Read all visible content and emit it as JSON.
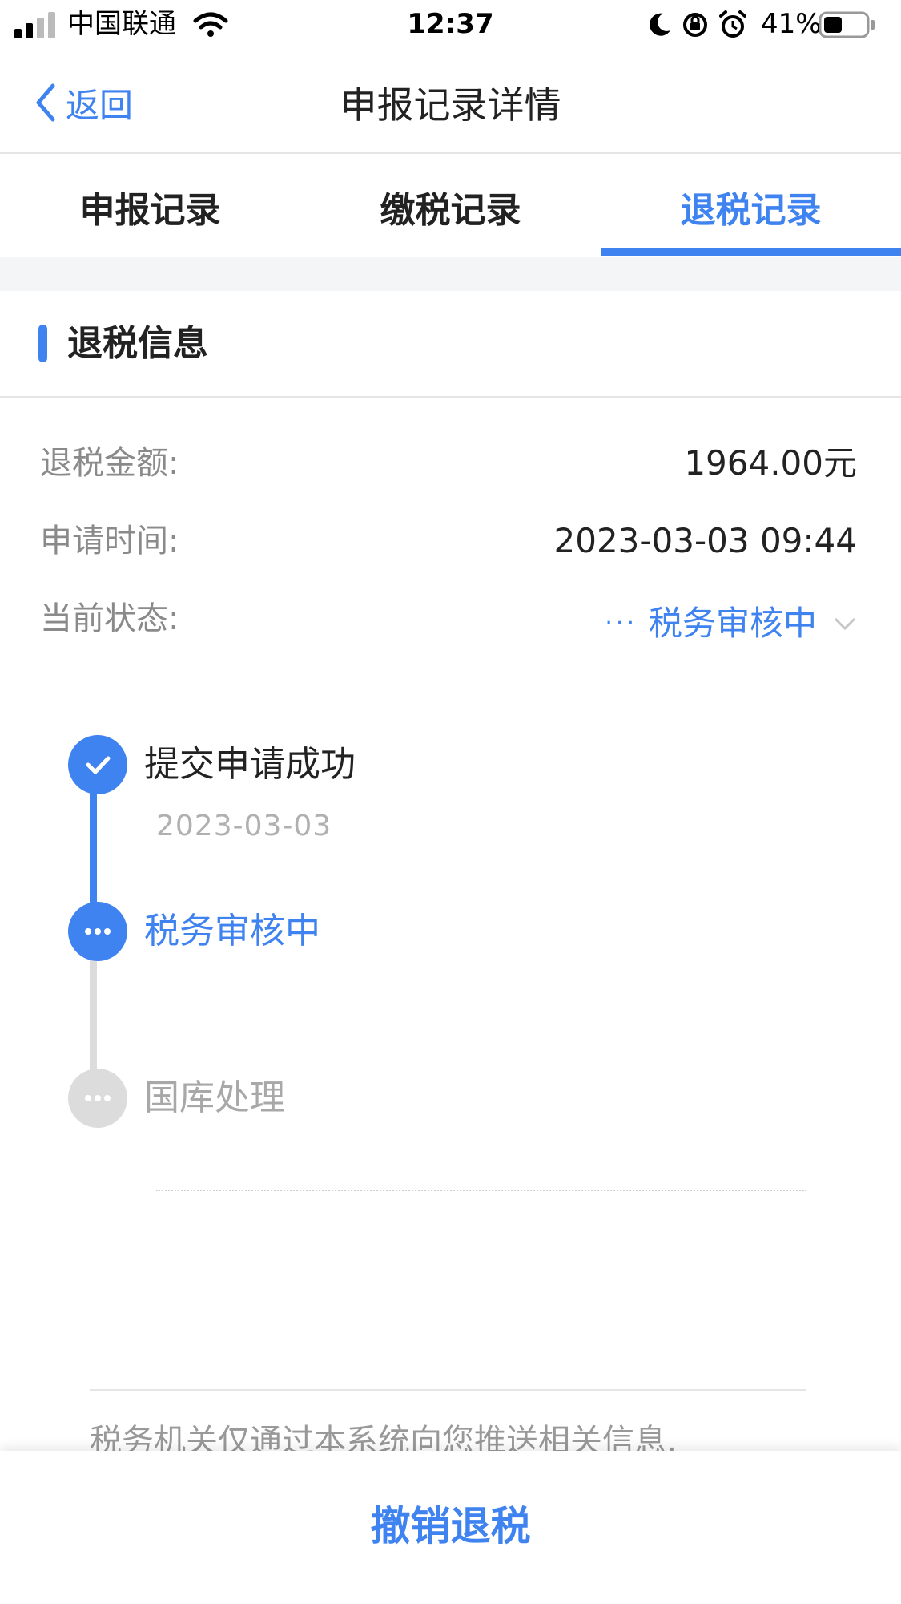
{
  "status_bar": {
    "carrier": "中国联通",
    "time": "12:37",
    "battery_percent": "41%"
  },
  "nav": {
    "back_label": "返回",
    "title": "申报记录详情"
  },
  "tabs": [
    {
      "label": "申报记录",
      "active": false
    },
    {
      "label": "缴税记录",
      "active": false
    },
    {
      "label": "退税记录",
      "active": true
    }
  ],
  "section": {
    "title": "退税信息"
  },
  "info": {
    "amount_label": "退税金额:",
    "amount_value": "1964.00元",
    "time_label": "申请时间:",
    "time_value": "2023-03-03 09:44",
    "status_label": "当前状态:",
    "status_dots": "···",
    "status_value": "税务审核中"
  },
  "timeline": [
    {
      "title": "提交申请成功",
      "date": "2023-03-03",
      "state": "done"
    },
    {
      "title": "税务审核中",
      "state": "current"
    },
    {
      "title": "国库处理",
      "state": "pending"
    }
  ],
  "footer_note": "税务机关仅通过本系统向您推送相关信息,",
  "bottom_button": "撤销退税",
  "colors": {
    "accent": "#3f83f0",
    "pending": "#dcdcdc",
    "label": "#8a8a8a"
  }
}
